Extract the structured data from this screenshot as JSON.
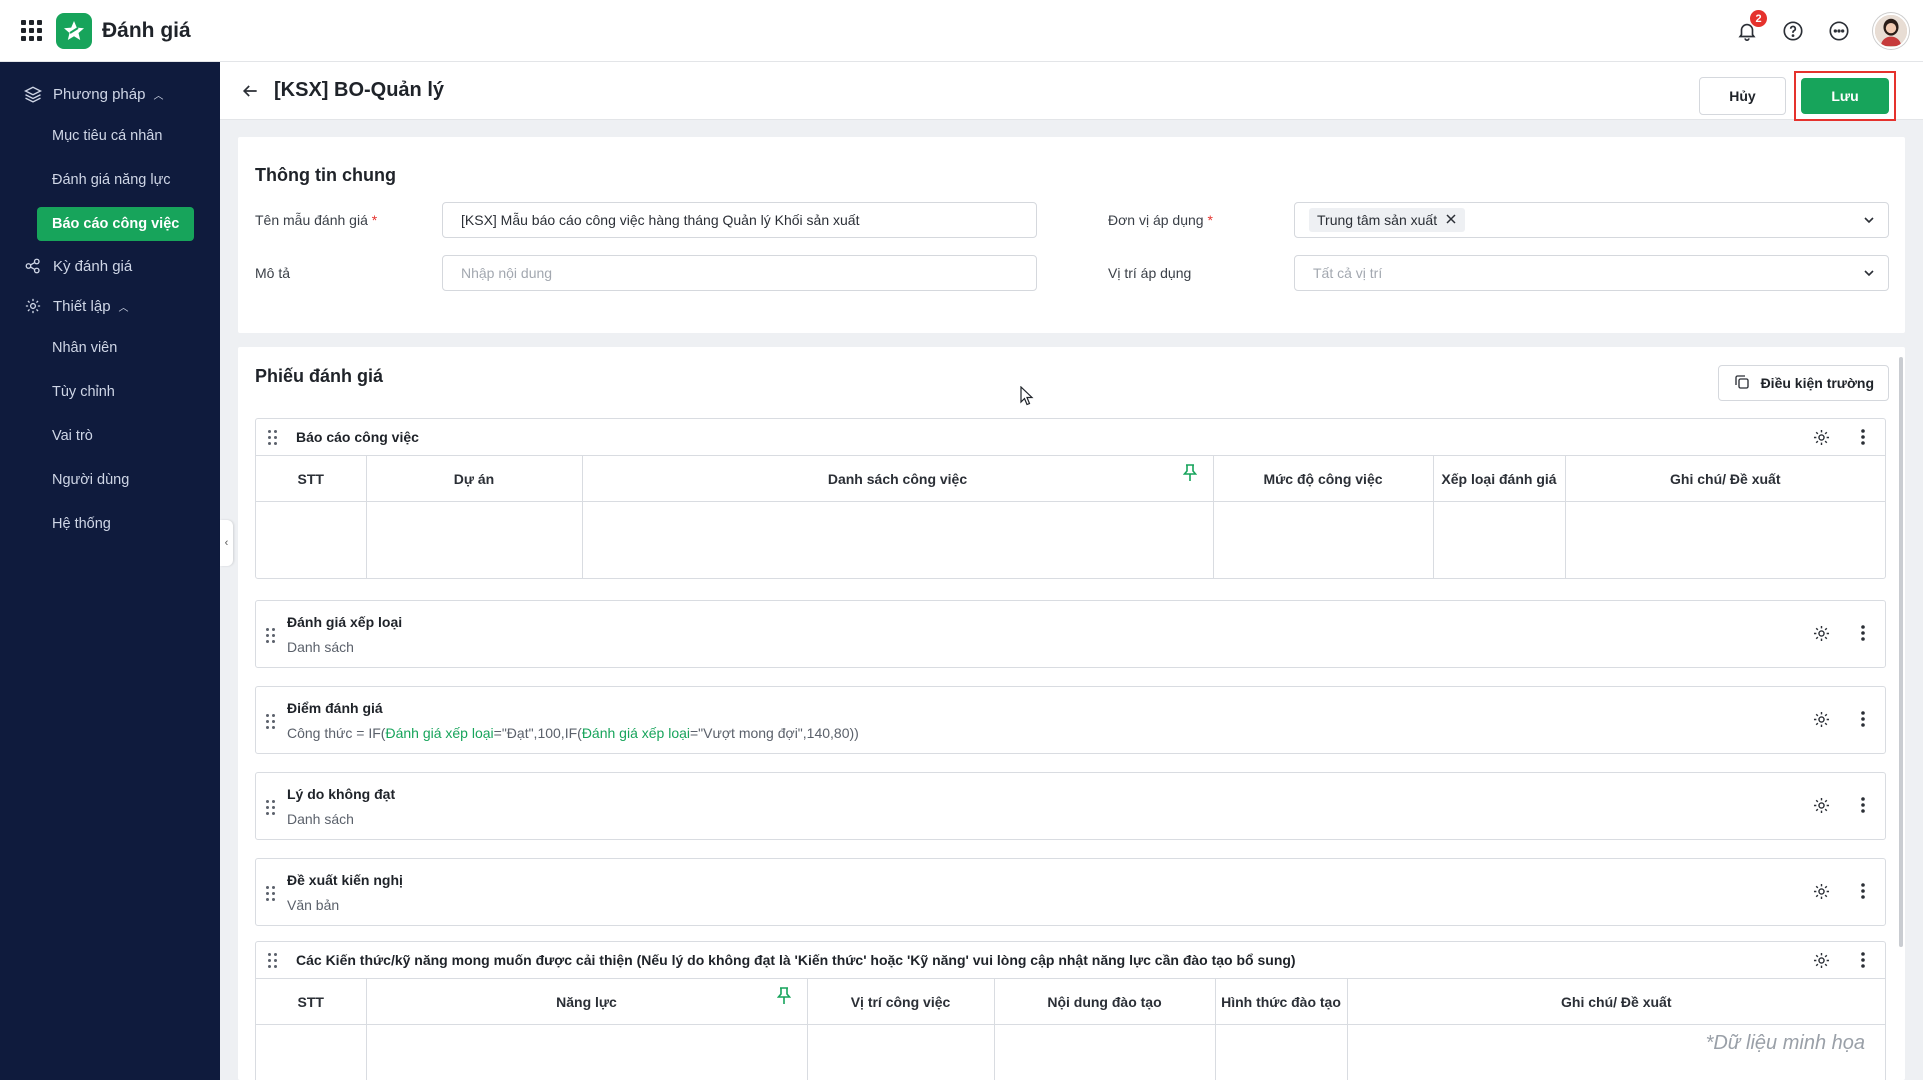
{
  "app": {
    "title": "Đánh giá"
  },
  "notifications": {
    "count": "2"
  },
  "sidebar": {
    "groups": [
      {
        "label": "Phương pháp",
        "icon": "layers-icon"
      },
      {
        "label": "Kỳ đánh giá",
        "icon": "cycle-icon"
      },
      {
        "label": "Thiết lập",
        "icon": "gear-icon"
      }
    ],
    "method_items": [
      "Mục tiêu cá nhân",
      "Đánh giá năng lực",
      "Báo cáo công việc"
    ],
    "settings_items": [
      "Nhân viên",
      "Tùy chỉnh",
      "Vai trò",
      "Người dùng",
      "Hệ thống"
    ]
  },
  "header": {
    "title": "[KSX] BO-Quản lý",
    "cancel_label": "Hủy",
    "save_label": "Lưu"
  },
  "general": {
    "title": "Thông tin chung",
    "template_name_label": "Tên mẫu đánh giá",
    "template_name_value": "[KSX] Mẫu báo cáo công việc hàng tháng Quản lý Khối sản xuất",
    "description_label": "Mô tả",
    "description_placeholder": "Nhập nội dung",
    "unit_label": "Đơn vị áp dụng",
    "unit_chip": "Trung tâm sản xuất",
    "position_label": "Vị trí áp dụng",
    "position_placeholder": "Tất cả vị trí",
    "required_mark": "*"
  },
  "form": {
    "title": "Phiếu đánh giá",
    "condition_button": "Điều kiện trường",
    "report_section": {
      "title": "Báo cáo công việc",
      "columns": [
        "STT",
        "Dự án",
        "Danh sách công việc",
        "Mức độ công việc",
        "Xếp loại đánh giá",
        "Ghi chú/ Đề xuất"
      ]
    },
    "items": [
      {
        "title": "Đánh giá xếp loại",
        "sub": "Danh sách"
      },
      {
        "title": "Điểm đánh giá",
        "sub_prefix": "Công thức = IF(",
        "sub_ref1": "Đánh giá xếp loại",
        "sub_mid": "=\"Đạt\",100,IF(",
        "sub_ref2": "Đánh giá xếp loại",
        "sub_suffix": "=\"Vượt mong đợi\",140,80))"
      },
      {
        "title": "Lý do không đạt",
        "sub": "Danh sách"
      },
      {
        "title": "Đề xuất kiến nghị",
        "sub": "Văn bản"
      }
    ],
    "skills_section": {
      "title": "Các Kiến thức/kỹ năng mong muốn được cải thiện (Nếu lý do không đạt là 'Kiến thức' hoặc 'Kỹ năng' vui lòng cập nhật năng lực cần đào tạo bổ sung)",
      "columns": [
        "STT",
        "Năng lực",
        "Vị trí công việc",
        "Nội dung đào tạo",
        "Hình thức đào tạo",
        "Ghi chú/ Đề xuất"
      ]
    },
    "watermark": "*Dữ liệu minh họa"
  },
  "colors": {
    "accent": "#17a45b",
    "sidebar": "#0f1b3d",
    "highlight": "#e5322d"
  }
}
